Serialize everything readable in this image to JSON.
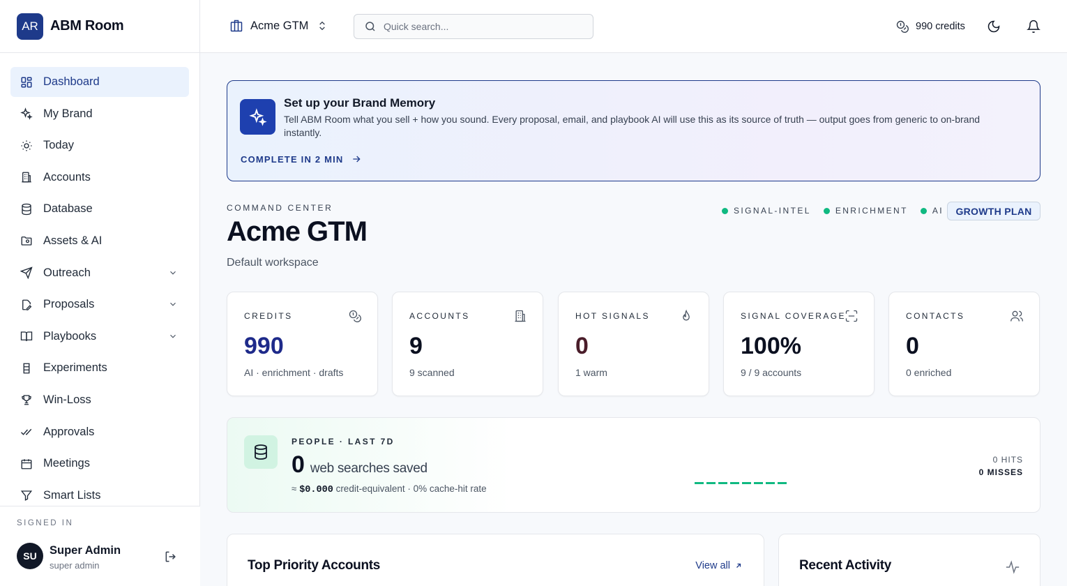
{
  "app": {
    "logo_initials": "AR",
    "name": "ABM Room"
  },
  "sidebar": {
    "items": [
      {
        "label": "Dashboard",
        "icon": "dashboard-grid-icon"
      },
      {
        "label": "My Brand",
        "icon": "sparkles-icon"
      },
      {
        "label": "Today",
        "icon": "sun-icon"
      },
      {
        "label": "Accounts",
        "icon": "building-icon"
      },
      {
        "label": "Database",
        "icon": "database-icon"
      },
      {
        "label": "Assets & AI",
        "icon": "folder-icon"
      },
      {
        "label": "Outreach",
        "icon": "send-icon"
      },
      {
        "label": "Proposals",
        "icon": "document-edit-icon"
      },
      {
        "label": "Playbooks",
        "icon": "book-icon"
      },
      {
        "label": "Experiments",
        "icon": "beaker-icon"
      },
      {
        "label": "Win-Loss",
        "icon": "trophy-icon"
      },
      {
        "label": "Approvals",
        "icon": "double-check-icon"
      },
      {
        "label": "Meetings",
        "icon": "calendar-icon"
      },
      {
        "label": "Smart Lists",
        "icon": "filter-icon"
      }
    ],
    "active": "Dashboard",
    "signed_in_label": "SIGNED IN",
    "user": {
      "initials": "SU",
      "name": "Super Admin",
      "role": "super admin"
    }
  },
  "topbar": {
    "workspace": "Acme GTM",
    "search_placeholder": "Quick search...",
    "credits": "990 credits"
  },
  "banner": {
    "title": "Set up your Brand Memory",
    "text": "Tell ABM Room what you sell + how you sound. Every proposal, email, and playbook AI will use this as its source of truth — output goes from generic to on-brand instantly.",
    "cta": "COMPLETE IN 2 MIN"
  },
  "command_center": {
    "label": "COMMAND CENTER",
    "title": "Acme GTM",
    "subtitle": "Default workspace",
    "statuses": [
      "SIGNAL-INTEL",
      "ENRICHMENT",
      "AI"
    ],
    "plan": "GROWTH PLAN",
    "status_color": "#10b981"
  },
  "stats": [
    {
      "label": "CREDITS",
      "value": "990",
      "sub": "AI · enrichment · drafts",
      "icon": "coins-icon"
    },
    {
      "label": "ACCOUNTS",
      "value": "9",
      "sub": "9 scanned",
      "icon": "building-icon"
    },
    {
      "label": "HOT SIGNALS",
      "value": "0",
      "sub": "1 warm",
      "icon": "flame-icon"
    },
    {
      "label": "SIGNAL COVERAGE",
      "value": "100%",
      "sub": "9 / 9 accounts",
      "icon": "scan-icon"
    },
    {
      "label": "CONTACTS",
      "value": "0",
      "sub": "0 enriched",
      "icon": "users-icon"
    }
  ],
  "people": {
    "label": "PEOPLE · LAST 7D",
    "value": "0",
    "unit": "web searches saved",
    "approx": "≈",
    "amount": "$0.000",
    "foot": "credit-equivalent · 0% cache-hit rate",
    "hits": "0 HITS",
    "misses": "0 MISSES"
  },
  "cards": {
    "top_priority": {
      "title": "Top Priority Accounts",
      "link": "View all"
    },
    "recent_activity": {
      "title": "Recent Activity"
    }
  },
  "colors": {
    "brand": "#1e3a8a",
    "accent_green": "#10b981"
  }
}
